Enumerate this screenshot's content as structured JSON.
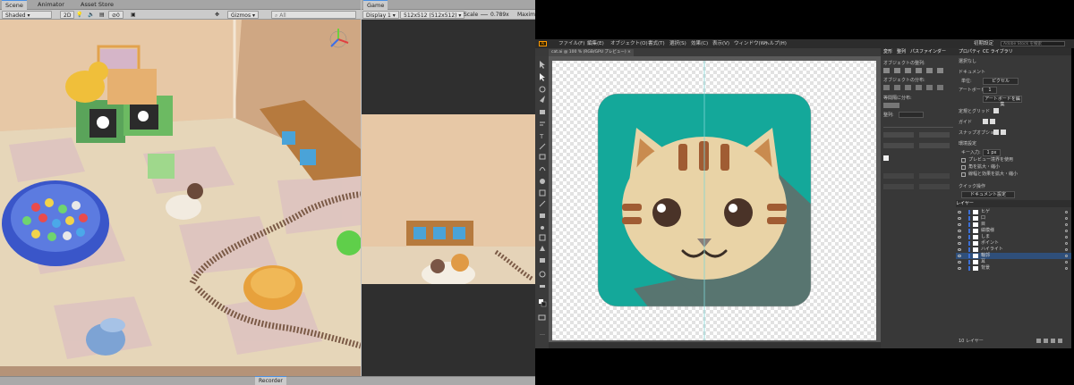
{
  "unity": {
    "tabs": [
      "Scene",
      "Animator",
      "Asset Store",
      "Game"
    ],
    "toolbar": {
      "shading": "Shaded",
      "mode2d": "2D",
      "layer_count": "0",
      "gizmos": "Gizmos",
      "search_placeholder": "All",
      "display": "Display 1",
      "resolution": "512x512 (512x512)",
      "scale_label": "Scale",
      "scale_value": "0.789x",
      "maximize": "Maxim"
    },
    "bottom_tab": "Recorder"
  },
  "illustrator": {
    "menu": [
      "ファイル(F)",
      "編集(E)",
      "オブジェクト(O)",
      "書式(T)",
      "選択(S)",
      "効果(C)",
      "表示(V)",
      "ウィンドウ(W)",
      "ヘルプ(H)"
    ],
    "workspace": "初期設定",
    "search_placeholder": "Adobe Stock を検索",
    "doc_tab": "cat.ai @ 100 % (RGB/GPU プレビュー)",
    "panel_tabs": [
      "変形",
      "整列",
      "パスファインダー"
    ],
    "align_labels": [
      "オブジェクトの整列:",
      "オブジェクトの分布:",
      "等間隔に分布:",
      "整列:"
    ],
    "props_tabs": [
      "プロパティ",
      "CC ライブラリ"
    ],
    "props": {
      "none_selected": "選択なし",
      "document": "ドキュメント",
      "unit_label": "単位:",
      "unit_value": "ピクセル",
      "artboard_label": "アートボード:",
      "artboard_value": "1",
      "edit_artboard": "アートボードを編集",
      "ruler_grid": "定規とグリッド",
      "guides": "ガイド",
      "snap": "スナップオプション",
      "preferences": "環境設定",
      "key_increment_label": "キー入力:",
      "key_increment_value": "1 px",
      "preview_bounds": "プレビュー境界を使用",
      "scale_corners": "角を拡大・縮小",
      "scale_strokes": "線幅と効果を拡大・縮小",
      "quick_actions": "クイック操作",
      "doc_setup": "ドキュメント設定"
    },
    "layers_title": "レイヤー",
    "layers": [
      "ヒゲ",
      "口",
      "目",
      "縞模様",
      "しま",
      "ポイント",
      "ハイライト",
      "輪郭",
      "耳",
      "背景"
    ],
    "layers_count": "10 レイヤー"
  },
  "colors": {
    "cat_bg": "#14a89a",
    "cat_shadow": "#587570",
    "cat_face": "#e9d3a6",
    "cat_stripe": "#a05c33",
    "guide": "#7fd5d5"
  }
}
